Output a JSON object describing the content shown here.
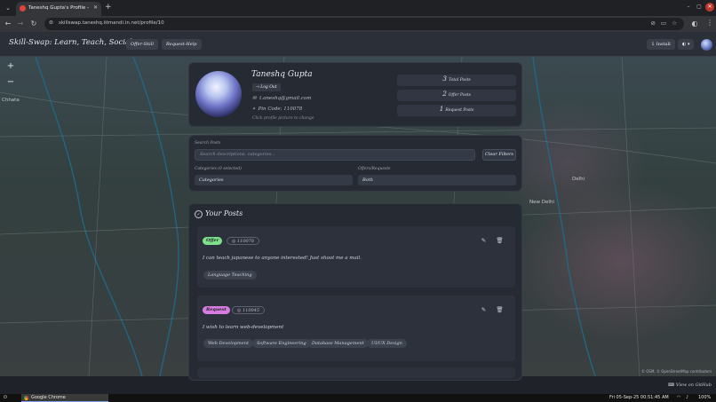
{
  "browser": {
    "tab_title": "Taneshq Gupta's Profile - Sk",
    "url": "skillswap.taneshq.iitmandi.in.net/profile/10"
  },
  "header": {
    "brand": "Skill-Swap: Learn, Teach, Socialise",
    "offer_skill": "Offer-Skill",
    "request_help": "Request-Help",
    "install": "Install"
  },
  "map": {
    "labels": [
      "Chhata",
      "New Delhi",
      "Delhi"
    ],
    "attribution": "© OSM, © OpenStreetMap contributors"
  },
  "profile": {
    "name": "Taneshq Gupta",
    "logout": "Log Out",
    "email": "t.aneshq@gmail.com",
    "pin": "Pin Code: 110078",
    "hint": "Click profile picture to change",
    "stats": [
      {
        "num": "3",
        "label": "Total Posts"
      },
      {
        "num": "2",
        "label": "Offer Posts"
      },
      {
        "num": "1",
        "label": "Request Posts"
      }
    ]
  },
  "filters": {
    "search_label": "Search Posts",
    "search_placeholder": "Search descriptions, categories...",
    "clear": "Clear Filters",
    "categories_label": "Categories (0 selected)",
    "categories_value": "Categories",
    "offers_label": "Offers/Requests",
    "offers_value": "Both"
  },
  "posts": {
    "title": "Your Posts",
    "items": [
      {
        "type": "Offer",
        "pin": "110078",
        "desc": "I can teach japanese to anyone interested! Just shoot me a mail.",
        "tags": [
          "Language Teaching"
        ],
        "color": "#7ee08a"
      },
      {
        "type": "Request",
        "pin": "110045",
        "desc": "I wish to learn web-development",
        "tags": [
          "Web Development",
          "Software Engineering",
          "Database Management",
          "UI/UX Design"
        ],
        "color": "#d77be0"
      }
    ]
  },
  "github": "View on GitHub",
  "taskbar": {
    "app": "Google Chrome",
    "clock": "Fri 05-Sep-25 00:51:45 AM",
    "battery": "100%"
  }
}
